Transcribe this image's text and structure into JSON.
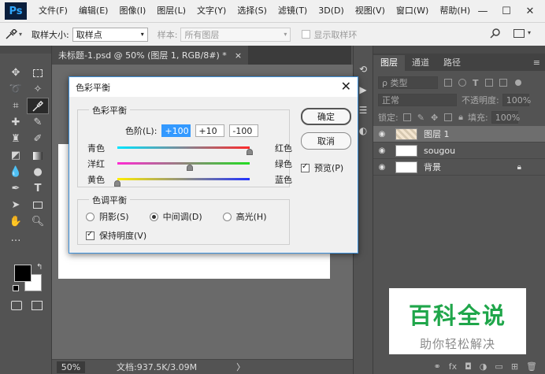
{
  "menubar": {
    "logo": "Ps",
    "items": [
      "文件(F)",
      "编辑(E)",
      "图像(I)",
      "图层(L)",
      "文字(Y)",
      "选择(S)",
      "滤镜(T)",
      "3D(D)",
      "视图(V)",
      "窗口(W)",
      "帮助(H)"
    ]
  },
  "options": {
    "sample_size_label": "取样大小:",
    "sample_size_value": "取样点",
    "sample_label": "样本:",
    "sample_value": "所有图层",
    "show_ring_label": "显示取样环"
  },
  "document": {
    "tab_title": "未标题-1.psd @ 50% (图层 1, RGB/8#) *",
    "tab_close": "×",
    "zoom": "50%",
    "doc_info": "文档:937.5K/3.09M",
    "status_arrow": "〉"
  },
  "layers_panel": {
    "tabs": [
      "图层",
      "通道",
      "路径"
    ],
    "filter_label": "ρ 类型",
    "blend_mode": "正常",
    "opacity_label": "不透明度:",
    "opacity_value": "100%",
    "lock_label": "锁定:",
    "fill_label": "填充:",
    "fill_value": "100%",
    "layers": [
      {
        "name": "图层 1"
      },
      {
        "name": "sougou"
      },
      {
        "name": "背景"
      }
    ]
  },
  "dialog": {
    "title": "色彩平衡",
    "close": "✕",
    "balance_group": "色彩平衡",
    "levels_label": "色阶(L):",
    "levels": [
      "+100",
      "+10",
      "-100"
    ],
    "sliders": [
      {
        "left": "青色",
        "right": "红色",
        "value": 100
      },
      {
        "left": "洋红",
        "right": "绿色",
        "value": 10
      },
      {
        "left": "黄色",
        "right": "蓝色",
        "value": -100
      }
    ],
    "tone_group": "色调平衡",
    "tone_options": [
      "阴影(S)",
      "中间调(D)",
      "高光(H)"
    ],
    "tone_selected": "中间调(D)",
    "preserve_label": "保持明度(V)",
    "ok_label": "确定",
    "cancel_label": "取消",
    "preview_label": "预览(P)"
  },
  "watermark": {
    "title": "百科全说",
    "subtitle": "助你轻松解决"
  }
}
